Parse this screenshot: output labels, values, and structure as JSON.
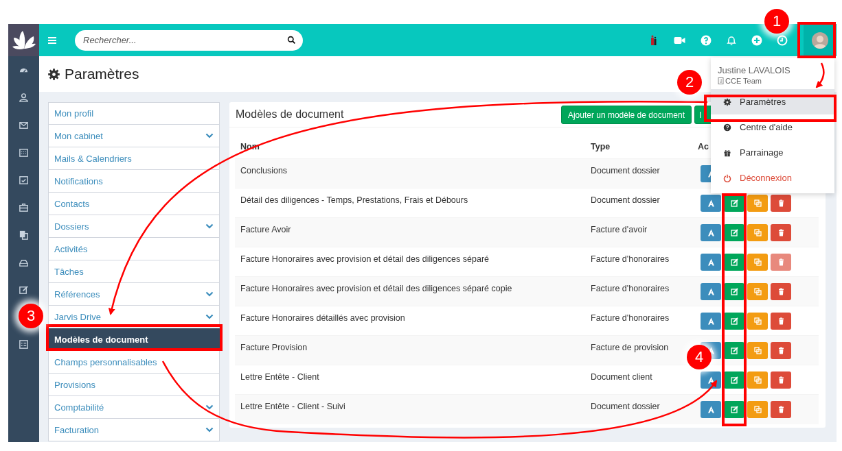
{
  "topbar": {
    "search": {
      "placeholder": "Rechercher..."
    }
  },
  "page": {
    "title": "Paramètres"
  },
  "settings_menu": {
    "items": [
      {
        "label": "Mon profil",
        "expandable": false,
        "selected": false
      },
      {
        "label": "Mon cabinet",
        "expandable": true,
        "selected": false
      },
      {
        "label": "Mails & Calendriers",
        "expandable": false,
        "selected": false
      },
      {
        "label": "Notifications",
        "expandable": false,
        "selected": false
      },
      {
        "label": "Contacts",
        "expandable": false,
        "selected": false
      },
      {
        "label": "Dossiers",
        "expandable": true,
        "selected": false
      },
      {
        "label": "Activités",
        "expandable": false,
        "selected": false
      },
      {
        "label": "Tâches",
        "expandable": false,
        "selected": false
      },
      {
        "label": "Références",
        "expandable": true,
        "selected": false
      },
      {
        "label": "Jarvis Drive",
        "expandable": true,
        "selected": false
      },
      {
        "label": "Modèles de document",
        "expandable": false,
        "selected": true
      },
      {
        "label": "Champs personnalisables",
        "expandable": false,
        "selected": false
      },
      {
        "label": "Provisions",
        "expandable": false,
        "selected": false
      },
      {
        "label": "Comptabilité",
        "expandable": true,
        "selected": false
      },
      {
        "label": "Facturation",
        "expandable": true,
        "selected": false
      }
    ]
  },
  "panel": {
    "title": "Modèles de document",
    "buttons": [
      "Ajouter un modèle de document",
      "I"
    ],
    "table": {
      "columns": [
        "Nom",
        "Type",
        "Ac"
      ],
      "rows": [
        {
          "name": "Conclusions",
          "type": "Document dossier"
        },
        {
          "name": "Détail des diligences - Temps, Prestations, Frais et Débours",
          "type": "Document dossier",
          "delete_disabled": false
        },
        {
          "name": "Facture Avoir",
          "type": "Facture d'avoir",
          "delete_disabled": false
        },
        {
          "name": "Facture Honoraires avec provision et détail des diligences séparé",
          "type": "Facture d'honoraires",
          "delete_disabled": true
        },
        {
          "name": "Facture Honoraires avec provision et détail des diligences séparé copie",
          "type": "Facture d'honoraires",
          "delete_disabled": false
        },
        {
          "name": "Facture Honoraires détaillés avec provision",
          "type": "Facture d'honoraires",
          "delete_disabled": false
        },
        {
          "name": "Facture Provision",
          "type": "Facture de provision",
          "delete_disabled": false
        },
        {
          "name": "Lettre Entête - Client",
          "type": "Document client",
          "delete_disabled": false
        },
        {
          "name": "Lettre Entête - Client - Suivi",
          "type": "Document dossier",
          "delete_disabled": false
        }
      ]
    }
  },
  "user_menu": {
    "name": "Justine LAVALOIS",
    "team": "CCE Team",
    "items": [
      {
        "kind": "settings",
        "label": "Paramètres",
        "selected": true
      },
      {
        "kind": "help",
        "label": "Centre d'aide",
        "selected": false
      },
      {
        "kind": "gift",
        "label": "Parrainage",
        "selected": false
      },
      {
        "kind": "logout",
        "label": "Déconnexion",
        "selected": false
      }
    ]
  },
  "annotations": {
    "badges": [
      "1",
      "2",
      "3",
      "4"
    ]
  }
}
